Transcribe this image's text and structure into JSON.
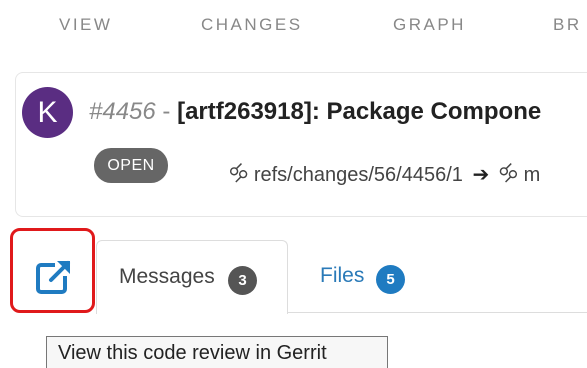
{
  "top_nav": {
    "items": [
      {
        "label": "VIEW"
      },
      {
        "label": "CHANGES"
      },
      {
        "label": "GRAPH"
      },
      {
        "label": "BR"
      }
    ]
  },
  "change": {
    "avatar_letter": "K",
    "number": "#4456",
    "separator": " - ",
    "subject": "[artf263918]: Package Compone",
    "status": "OPEN",
    "source_ref": "refs/changes/56/4456/1",
    "target_ref": "m"
  },
  "tabs": {
    "open_in_gerrit_icon": "external-link-icon",
    "messages": {
      "label": "Messages",
      "count": "3"
    },
    "files": {
      "label": "Files",
      "count": "5"
    }
  },
  "tooltip": {
    "text": "View this code review in Gerrit"
  },
  "colors": {
    "avatar": "#5a2d82",
    "highlight": "#e0191b",
    "link": "#2a7ab8",
    "files_badge": "#1f7bc1",
    "status_badge": "#666666"
  }
}
